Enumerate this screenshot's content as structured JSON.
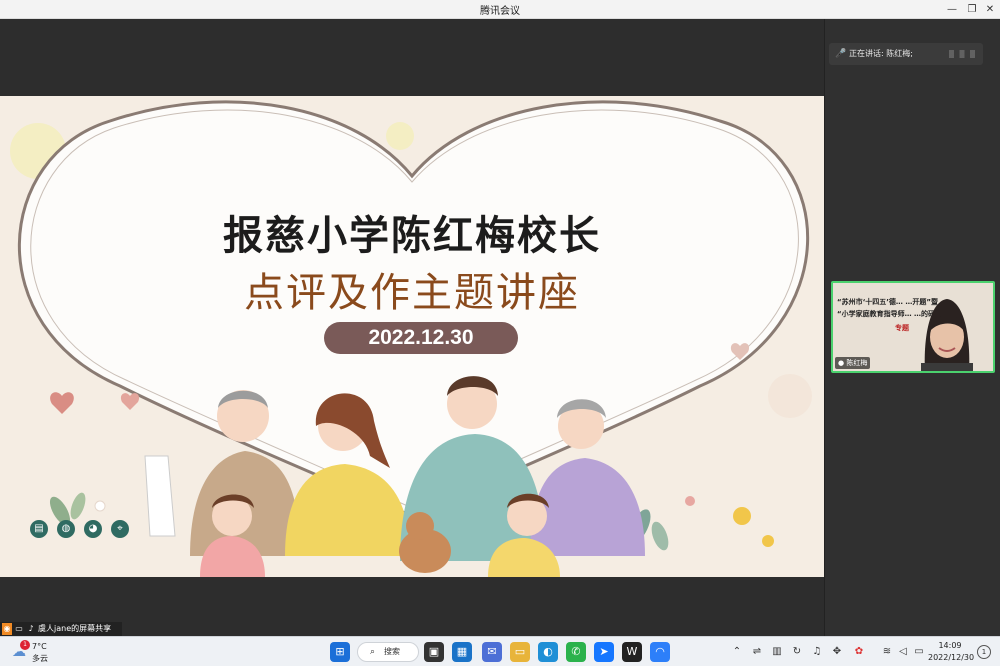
{
  "window": {
    "title": "腾讯会议"
  },
  "slide": {
    "title": "报慈小学陈红梅校长",
    "subtitle": "点评及作主题讲座",
    "date": "2022.12.30"
  },
  "side_panel": {
    "speaking_label": "正在讲话: 陈红梅;",
    "video": {
      "line1": "“苏州市‘十四五’德…    …开题”暨",
      "line2": "“小学家庭教育指导师…    …的研究”",
      "line3": "专题",
      "name": "陈红梅"
    }
  },
  "share_status": {
    "text": "虞人jane的屏幕共享"
  },
  "taskbar": {
    "weather_temp": "7°C",
    "weather_cond": "多云",
    "weather_badge": "1",
    "search_label": "搜索",
    "time": "14:09",
    "date": "2022/12/30",
    "notification_count": "1"
  },
  "colors": {
    "slide_bg": "#f5ede3",
    "title": "#1c1c1c",
    "subtitle": "#8a4a1c",
    "date_pill": "#7a5a58",
    "speaker_border": "#4bd16e"
  }
}
